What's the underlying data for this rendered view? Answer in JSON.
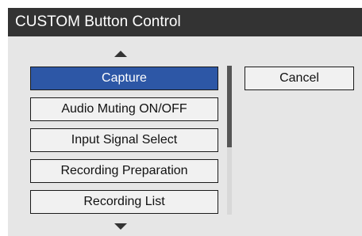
{
  "window": {
    "title": "CUSTOM Button Control"
  },
  "list": {
    "items": [
      {
        "label": "Capture",
        "selected": true
      },
      {
        "label": "Audio Muting ON/OFF",
        "selected": false
      },
      {
        "label": "Input Signal Select",
        "selected": false
      },
      {
        "label": "Recording Preparation",
        "selected": false
      },
      {
        "label": "Recording List",
        "selected": false
      }
    ],
    "scroll_up_icon": "triangle-up-icon",
    "scroll_down_icon": "triangle-down-icon",
    "scroll_position": 0.0,
    "visible_fraction": 0.55
  },
  "actions": {
    "cancel_label": "Cancel"
  },
  "colors": {
    "title_bar": "#333333",
    "panel": "#e6e6e6",
    "selected": "#2d57a6"
  }
}
